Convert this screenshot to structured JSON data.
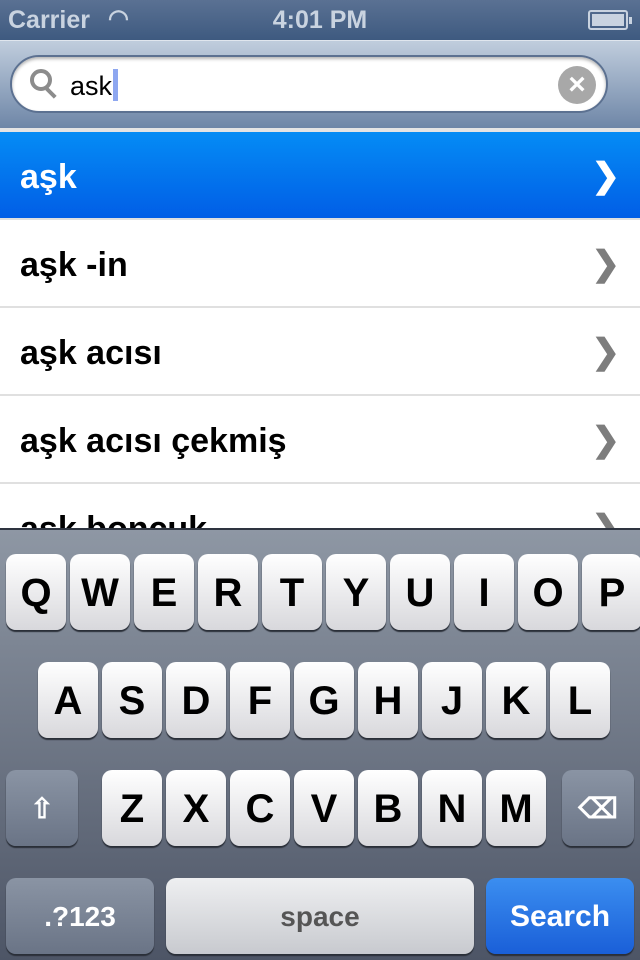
{
  "status_bar": {
    "carrier": "Carrier",
    "time": "4:01 PM",
    "wifi_icon": "wifi-icon",
    "battery_icon": "battery-icon"
  },
  "search": {
    "value": "ask",
    "icon": "search-icon",
    "clear_icon": "clear-icon"
  },
  "results": [
    {
      "label": "aşk",
      "selected": true
    },
    {
      "label": "aşk -in"
    },
    {
      "label": "aşk acısı"
    },
    {
      "label": "aşk acısı çekmiş"
    },
    {
      "label": "aşk boncuk"
    }
  ],
  "colors": {
    "selection": "#0378ef",
    "search_key": "#2a73e4"
  },
  "keyboard": {
    "row1": [
      "Q",
      "W",
      "E",
      "R",
      "T",
      "Y",
      "U",
      "I",
      "O",
      "P"
    ],
    "row2": [
      "A",
      "S",
      "D",
      "F",
      "G",
      "H",
      "J",
      "K",
      "L"
    ],
    "row3": [
      "Z",
      "X",
      "C",
      "V",
      "B",
      "N",
      "M"
    ],
    "numbers": ".?123",
    "space": "space",
    "search": "Search",
    "shift_icon": "shift-icon",
    "delete_icon": "backspace-icon"
  }
}
